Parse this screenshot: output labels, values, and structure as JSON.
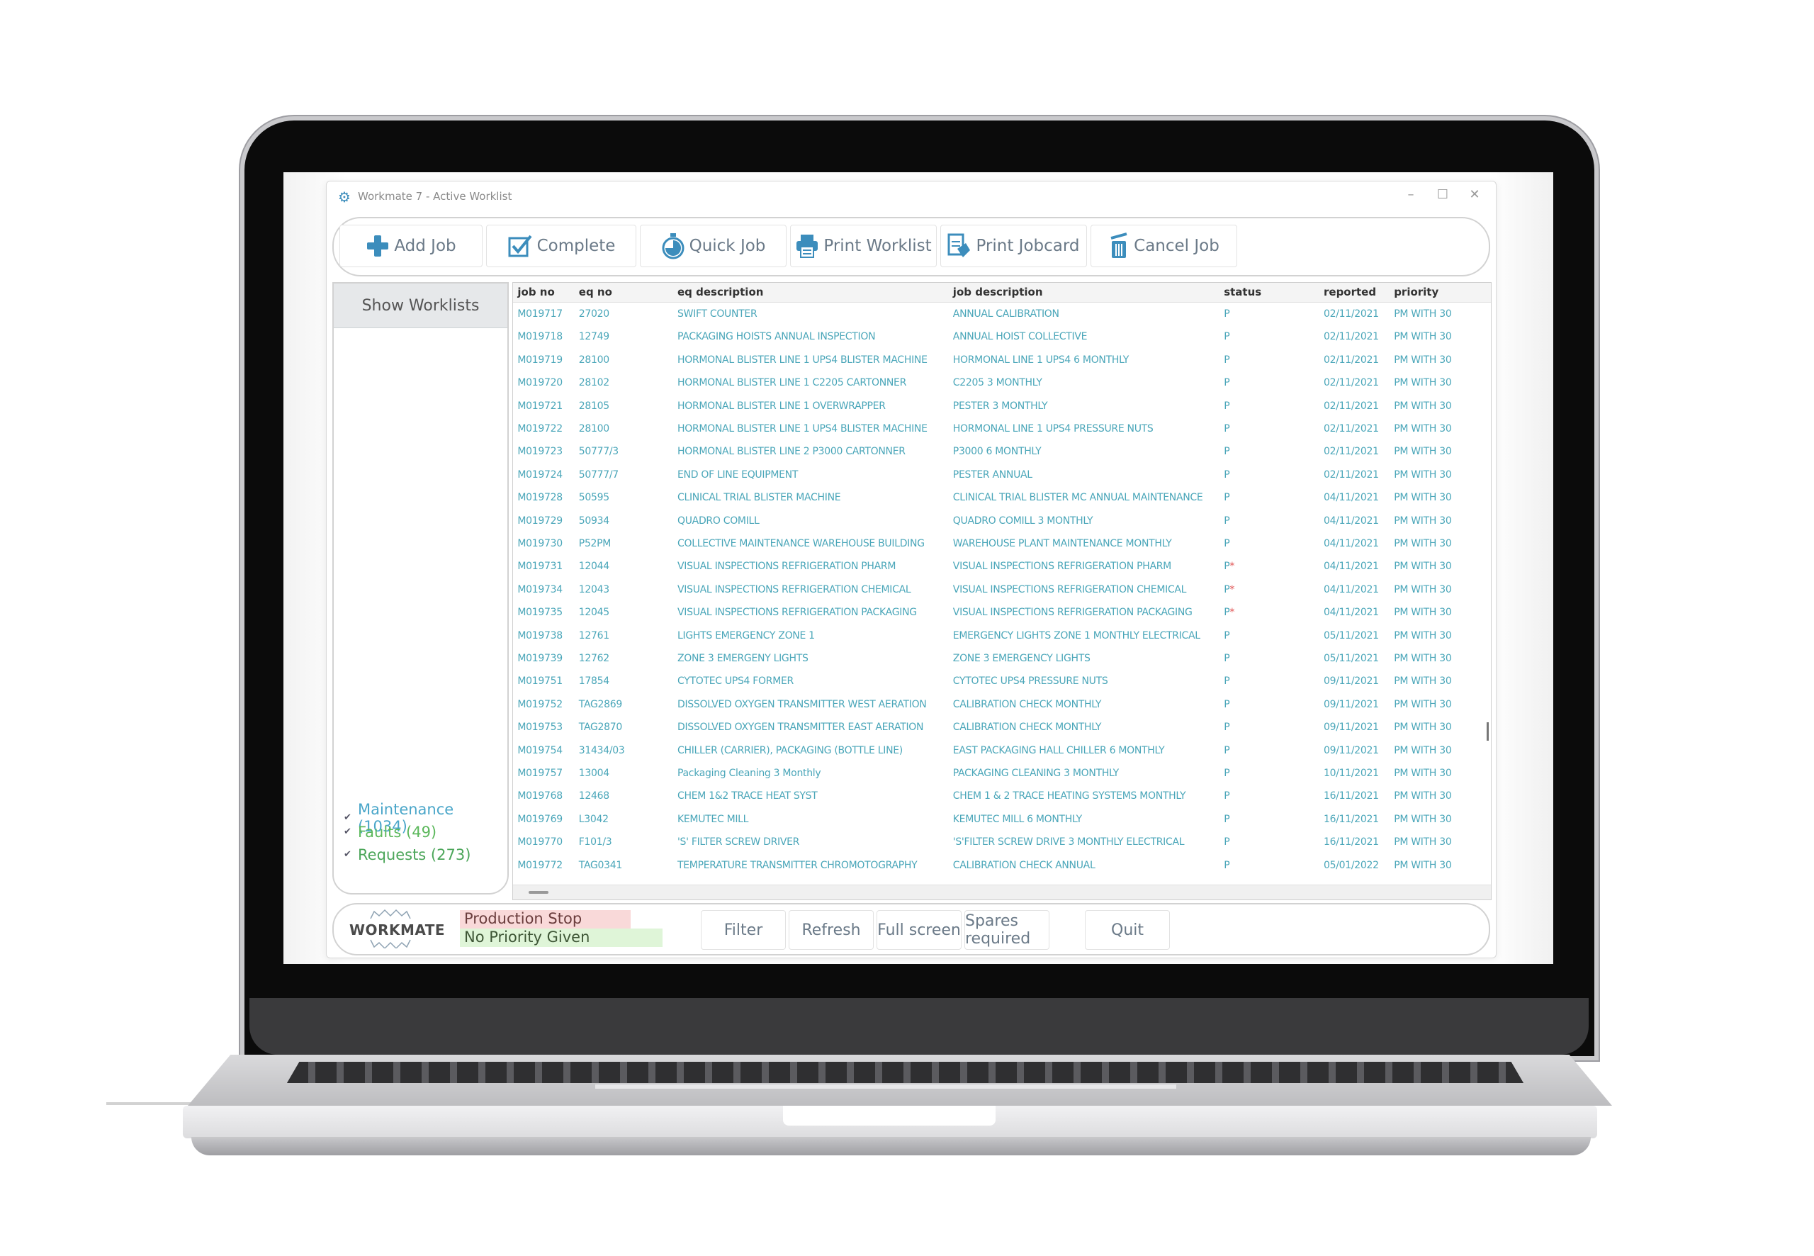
{
  "window": {
    "title": "Workmate 7 - Active Worklist",
    "icon": "gear-icon",
    "controls": {
      "minimize": "–",
      "maximize": "☐",
      "close": "✕"
    }
  },
  "toolbar": {
    "buttons": [
      {
        "label": "Add Job",
        "icon": "plus-icon"
      },
      {
        "label": "Complete",
        "icon": "checkbox-icon"
      },
      {
        "label": "Quick Job",
        "icon": "stopwatch-icon"
      },
      {
        "label": "Print Worklist",
        "icon": "printer-icon"
      },
      {
        "label": "Print Jobcard",
        "icon": "jobcard-icon"
      },
      {
        "label": "Cancel Job",
        "icon": "trash-icon"
      }
    ]
  },
  "sidebar": {
    "show_worklists": "Show Worklists",
    "filters": [
      {
        "label": "Maintenance (1034)",
        "checked": true,
        "color": "#4aa6c9"
      },
      {
        "label": "Faults (49)",
        "checked": true,
        "color": "#5cb85c"
      },
      {
        "label": "Requests (273)",
        "checked": true,
        "color": "#4ca65a"
      }
    ]
  },
  "grid": {
    "columns": [
      "job no",
      "eq no",
      "eq description",
      "job description",
      "status",
      "reported",
      "priority"
    ],
    "rows": [
      [
        "M019717",
        "27020",
        "SWIFT COUNTER",
        "ANNUAL CALIBRATION",
        "P",
        "",
        "02/11/2021",
        "PM WITH 30"
      ],
      [
        "M019718",
        "12749",
        "PACKAGING HOISTS ANNUAL INSPECTION",
        "ANNUAL HOIST COLLECTIVE",
        "P",
        "",
        "02/11/2021",
        "PM WITH 30"
      ],
      [
        "M019719",
        "28100",
        "HORMONAL BLISTER LINE 1 UPS4 BLISTER MACHINE",
        "HORMONAL LINE 1 UPS4 6 MONTHLY",
        "P",
        "",
        "02/11/2021",
        "PM WITH 30"
      ],
      [
        "M019720",
        "28102",
        "HORMONAL BLISTER LINE 1 C2205 CARTONNER",
        "C2205 3 MONTHLY",
        "P",
        "",
        "02/11/2021",
        "PM WITH 30"
      ],
      [
        "M019721",
        "28105",
        "HORMONAL BLISTER LINE 1 OVERWRAPPER",
        "PESTER 3 MONTHLY",
        "P",
        "",
        "02/11/2021",
        "PM WITH 30"
      ],
      [
        "M019722",
        "28100",
        "HORMONAL BLISTER LINE 1 UPS4 BLISTER MACHINE",
        "HORMONAL LINE 1 UPS4 PRESSURE NUTS",
        "P",
        "",
        "02/11/2021",
        "PM WITH 30"
      ],
      [
        "M019723",
        "50777/3",
        "HORMONAL BLISTER LINE 2 P3000 CARTONNER",
        "P3000 6 MONTHLY",
        "P",
        "",
        "02/11/2021",
        "PM WITH 30"
      ],
      [
        "M019724",
        "50777/7",
        "END OF LINE EQUIPMENT",
        "PESTER ANNUAL",
        "P",
        "",
        "02/11/2021",
        "PM WITH 30"
      ],
      [
        "M019728",
        "50595",
        "CLINICAL TRIAL BLISTER MACHINE",
        "CLINICAL TRIAL BLISTER MC ANNUAL MAINTENANCE",
        "P",
        "",
        "04/11/2021",
        "PM WITH 30"
      ],
      [
        "M019729",
        "50934",
        "QUADRO COMILL",
        "QUADRO COMILL 3 MONTHLY",
        "P",
        "",
        "04/11/2021",
        "PM WITH 30"
      ],
      [
        "M019730",
        "P52PM",
        "COLLECTIVE MAINTENANCE WAREHOUSE BUILDING",
        "WAREHOUSE PLANT MAINTENANCE MONTHLY",
        "P",
        "",
        "04/11/2021",
        "PM WITH 30"
      ],
      [
        "M019731",
        "12044",
        "VISUAL INSPECTIONS REFRIGERATION PHARM",
        "VISUAL INSPECTIONS REFRIGERATION PHARM",
        "P",
        "*",
        "04/11/2021",
        "PM WITH 30"
      ],
      [
        "M019734",
        "12043",
        "VISUAL INSPECTIONS REFRIGERATION CHEMICAL",
        "VISUAL INSPECTIONS REFRIGERATION CHEMICAL",
        "P",
        "*",
        "04/11/2021",
        "PM WITH 30"
      ],
      [
        "M019735",
        "12045",
        "VISUAL INSPECTIONS REFRIGERATION PACKAGING",
        "VISUAL INSPECTIONS REFRIGERATION PACKAGING",
        "P",
        "*",
        "04/11/2021",
        "PM WITH 30"
      ],
      [
        "M019738",
        "12761",
        "LIGHTS EMERGENCY ZONE 1",
        "EMERGENCY LIGHTS ZONE 1 MONTHLY ELECTRICAL",
        "P",
        "",
        "05/11/2021",
        "PM WITH 30"
      ],
      [
        "M019739",
        "12762",
        "ZONE 3 EMERGENY LIGHTS",
        "ZONE 3 EMERGENCY LIGHTS",
        "P",
        "",
        "05/11/2021",
        "PM WITH 30"
      ],
      [
        "M019751",
        "17854",
        "CYTOTEC UPS4 FORMER",
        "CYTOTEC UPS4 PRESSURE NUTS",
        "P",
        "",
        "09/11/2021",
        "PM WITH 30"
      ],
      [
        "M019752",
        "TAG2869",
        "DISSOLVED OXYGEN TRANSMITTER  WEST AERATION",
        "CALIBRATION CHECK MONTHLY",
        "P",
        "",
        "09/11/2021",
        "PM WITH 30"
      ],
      [
        "M019753",
        "TAG2870",
        "DISSOLVED OXYGEN TRANSMITTER  EAST AERATION",
        "CALIBRATION CHECK MONTHLY",
        "P",
        "",
        "09/11/2021",
        "PM WITH 30"
      ],
      [
        "M019754",
        "31434/03",
        "CHILLER (CARRIER), PACKAGING (BOTTLE LINE)",
        "EAST PACKAGING HALL CHILLER 6 MONTHLY",
        "P",
        "",
        "09/11/2021",
        "PM WITH 30"
      ],
      [
        "M019757",
        "13004",
        "Packaging Cleaning  3 Monthly",
        "PACKAGING CLEANING 3 MONTHLY",
        "P",
        "",
        "10/11/2021",
        "PM WITH 30"
      ],
      [
        "M019768",
        "12468",
        "CHEM 1&2 TRACE HEAT SYST",
        "CHEM 1 & 2 TRACE HEATING SYSTEMS MONTHLY",
        "P",
        "",
        "16/11/2021",
        "PM WITH 30"
      ],
      [
        "M019769",
        "L3042",
        "KEMUTEC MILL",
        "KEMUTEC MILL 6 MONTHLY",
        "P",
        "",
        "16/11/2021",
        "PM WITH 30"
      ],
      [
        "M019770",
        "F101/3",
        "'S' FILTER SCREW DRIVER",
        "'S'FILTER SCREW DRIVE 3 MONTHLY ELECTRICAL",
        "P",
        "",
        "16/11/2021",
        "PM WITH 30"
      ],
      [
        "M019772",
        "TAG0341",
        "TEMPERATURE TRANSMITTER CHROMOTOGRAPHY",
        "CALIBRATION CHECK ANNUAL",
        "P",
        "",
        "05/01/2022",
        "PM WITH 30"
      ]
    ]
  },
  "bottombar": {
    "logo_text": "WORKMATE",
    "legend": [
      {
        "label": "Production Stop",
        "color": "#f9d9d9"
      },
      {
        "label": "No Priority Given",
        "color": "#dff5d8"
      }
    ],
    "buttons": [
      "Filter",
      "Refresh",
      "Full screen",
      "Spares required",
      "Quit"
    ]
  },
  "colors": {
    "accent": "#3c8dbc",
    "row_text": "#4aa6b9",
    "status_flag": "#e05454"
  }
}
